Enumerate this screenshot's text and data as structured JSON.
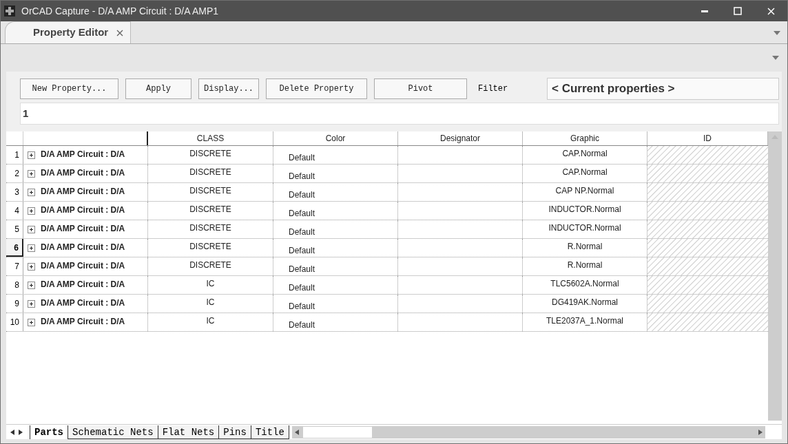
{
  "window": {
    "title": "OrCAD Capture - D/A AMP Circuit : D/A AMP1"
  },
  "doc_tabs": [
    {
      "label": "Property Editor",
      "selected": true
    }
  ],
  "toolbar": {
    "buttons": [
      "New Property...",
      "Apply",
      "Display...",
      "Delete Property",
      "Pivot"
    ],
    "filter_label": "Filter",
    "filter_value": "< Current properties >"
  },
  "cell_editor": {
    "value": "1"
  },
  "table": {
    "columns": [
      "",
      "CLASS",
      "Color",
      "Designator",
      "Graphic",
      "ID"
    ],
    "rows": [
      {
        "number": "1",
        "selected": false,
        "cells": [
          "D/A AMP Circuit : D/A",
          "DISCRETE",
          "Default",
          "",
          "CAP.Normal",
          ""
        ]
      },
      {
        "number": "2",
        "selected": false,
        "cells": [
          "D/A AMP Circuit : D/A",
          "DISCRETE",
          "Default",
          "",
          "CAP.Normal",
          ""
        ]
      },
      {
        "number": "3",
        "selected": false,
        "cells": [
          "D/A AMP Circuit : D/A",
          "DISCRETE",
          "Default",
          "",
          "CAP NP.Normal",
          ""
        ]
      },
      {
        "number": "4",
        "selected": false,
        "cells": [
          "D/A AMP Circuit : D/A",
          "DISCRETE",
          "Default",
          "",
          "INDUCTOR.Normal",
          ""
        ]
      },
      {
        "number": "5",
        "selected": false,
        "cells": [
          "D/A AMP Circuit : D/A",
          "DISCRETE",
          "Default",
          "",
          "INDUCTOR.Normal",
          ""
        ]
      },
      {
        "number": "6",
        "selected": true,
        "cells": [
          "D/A AMP Circuit : D/A",
          "DISCRETE",
          "Default",
          "",
          "R.Normal",
          ""
        ]
      },
      {
        "number": "7",
        "selected": false,
        "cells": [
          "D/A AMP Circuit : D/A",
          "DISCRETE",
          "Default",
          "",
          "R.Normal",
          ""
        ]
      },
      {
        "number": "8",
        "selected": false,
        "cells": [
          "D/A AMP Circuit : D/A",
          "IC",
          "Default",
          "",
          "TLC5602A.Normal",
          ""
        ]
      },
      {
        "number": "9",
        "selected": false,
        "cells": [
          "D/A AMP Circuit : D/A",
          "IC",
          "Default",
          "",
          "DG419AK.Normal",
          ""
        ]
      },
      {
        "number": "10",
        "selected": false,
        "cells": [
          "D/A AMP Circuit : D/A",
          "IC",
          "Default",
          "",
          "TLE2037A_1.Normal",
          ""
        ]
      }
    ]
  },
  "sheet_tabs": [
    {
      "label": "Parts",
      "selected": true
    },
    {
      "label": "Schematic Nets",
      "selected": false
    },
    {
      "label": "Flat Nets",
      "selected": false
    },
    {
      "label": "Pins",
      "selected": false
    },
    {
      "label": "Title",
      "selected": false
    }
  ]
}
